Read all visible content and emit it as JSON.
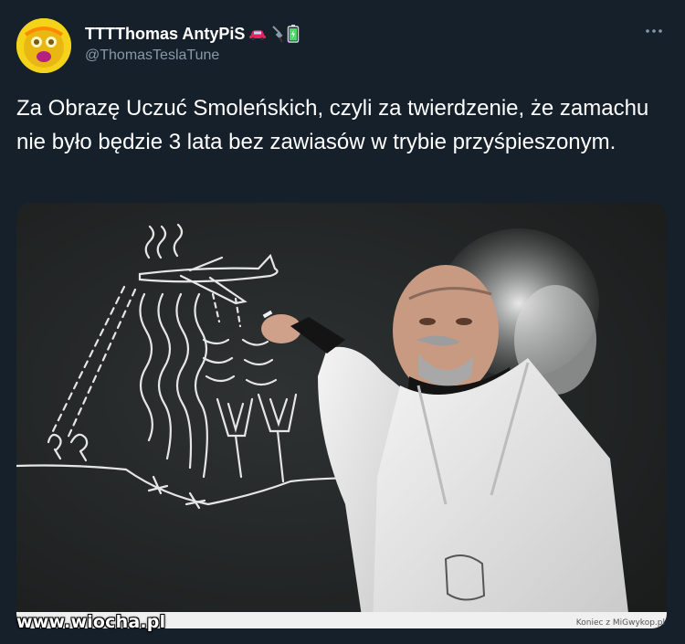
{
  "tweet": {
    "author": {
      "display_name": "TTTThomas AntyPiS",
      "handle": "@ThomasTeslaTune",
      "emojis": [
        "car-icon",
        "plug-icon",
        "battery-icon"
      ]
    },
    "more_icon": "more-horizontal-icon",
    "text": "Za Obrazę Uczuć Smoleńskich, czyli za twierdzenie, że zamachu nie było będzie 3 lata bez zawiasów w trybie przyśpieszonym.",
    "media": {
      "description_type": "photo",
      "credit": "Koniec z MiGwykop.pl"
    }
  },
  "watermark": "www.wiocha.pl",
  "colors": {
    "background": "#15202b",
    "text": "#ffffff",
    "secondary": "#8899a6",
    "chalkboard": "#262929"
  }
}
